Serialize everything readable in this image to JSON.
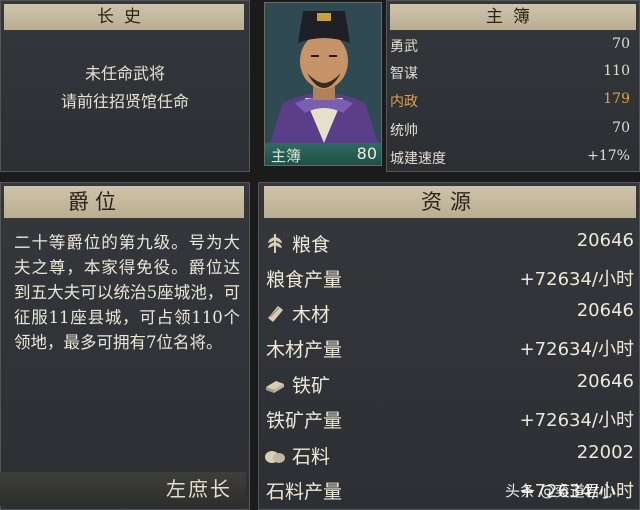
{
  "left_top": {
    "title": "长史",
    "line1": "未任命武将",
    "line2": "请前往招贤馆任命"
  },
  "portrait": {
    "name": "主簿",
    "level": "80"
  },
  "stats": {
    "title": "主簿",
    "rows": [
      {
        "label": "勇武",
        "value": "70"
      },
      {
        "label": "智谋",
        "value": "110"
      },
      {
        "label": "内政",
        "value": "179"
      },
      {
        "label": "统帅",
        "value": "70"
      },
      {
        "label": "城建速度",
        "value": "+17%"
      }
    ],
    "highlight_color": "#e0a04a"
  },
  "rank": {
    "title": "爵位",
    "description": "二十等爵位的第九级。号为大夫之尊，本家得免役。爵位达到五大夫可以统治5座城池，可征服11座县城，可占领110个领地，最多可拥有7位名将。",
    "next_rank": "左庶长"
  },
  "resources": {
    "title": "资源",
    "rows": [
      {
        "icon": "grain-icon",
        "label": "粮食",
        "value": "20646"
      },
      {
        "icon": "",
        "label": "粮食产量",
        "value": "+72634/小时"
      },
      {
        "icon": "wood-icon",
        "label": "木材",
        "value": "20646"
      },
      {
        "icon": "",
        "label": "木材产量",
        "value": "+72634/小时"
      },
      {
        "icon": "iron-icon",
        "label": "铁矿",
        "value": "20646"
      },
      {
        "icon": "",
        "label": "铁矿产量",
        "value": "+72634/小时"
      },
      {
        "icon": "stone-icon",
        "label": "石料",
        "value": "22002"
      },
      {
        "icon": "",
        "label": "石料产量",
        "value": "+72634/小时"
      }
    ]
  },
  "watermark": "头条 @奕道君心"
}
